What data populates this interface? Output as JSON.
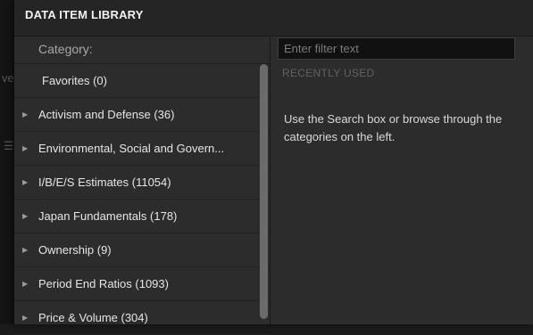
{
  "library": {
    "title": "DATA ITEM LIBRARY",
    "category_label": "Category:",
    "filter_placeholder": "Enter filter text",
    "recently_used_label": "RECENTLY USED",
    "help_text": "Use the Search box or browse through the categories on the left."
  },
  "categories": [
    {
      "label": "Favorites (0)",
      "expandable": false,
      "icon": "none"
    },
    {
      "label": "Activism and Defense (36)",
      "expandable": true,
      "icon": "triangle-right-icon"
    },
    {
      "label": "Environmental, Social and Govern...",
      "expandable": true,
      "icon": "triangle-right-icon"
    },
    {
      "label": "I/B/E/S Estimates (11054)",
      "expandable": true,
      "icon": "triangle-right-icon"
    },
    {
      "label": "Japan Fundamentals (178)",
      "expandable": true,
      "icon": "triangle-right-icon"
    },
    {
      "label": "Ownership (9)",
      "expandable": true,
      "icon": "triangle-right-icon"
    },
    {
      "label": "Period End Ratios (1093)",
      "expandable": true,
      "icon": "triangle-right-icon"
    },
    {
      "label": "Price & Volume (304)",
      "expandable": true,
      "icon": "triangle-right-icon"
    }
  ],
  "background": {
    "glyph_a": "ve",
    "glyph_b": "☰"
  },
  "colors": {
    "panel_bg": "#2c2c2c",
    "title_bg": "#252525",
    "input_bg": "#111111",
    "text_primary": "#e6e6e6",
    "text_muted": "#a8a8a8",
    "recently_used": "#616161",
    "scroll_thumb": "#6b6b6b"
  }
}
